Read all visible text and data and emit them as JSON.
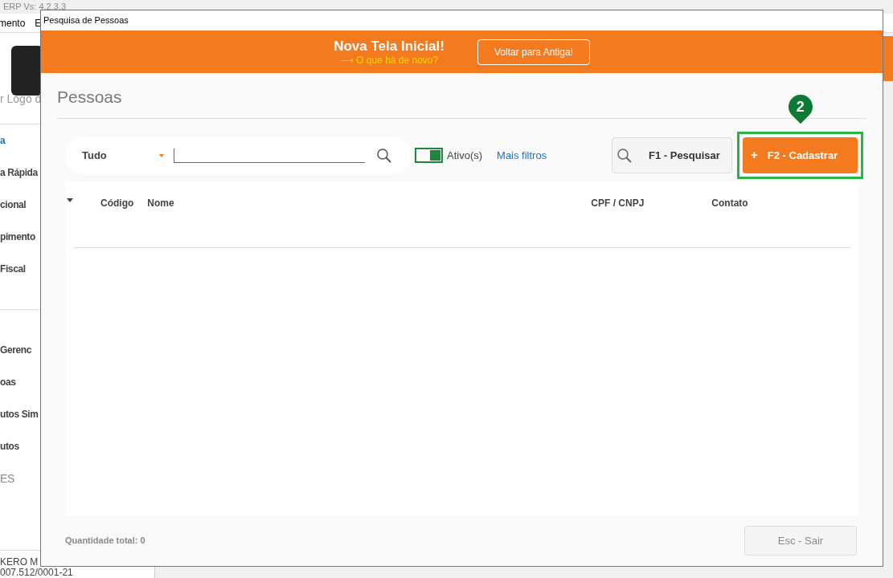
{
  "background_app": {
    "version": "ERP Vs: 4.2.3.3",
    "menu": [
      "mento",
      "E"
    ],
    "logo_caption": "r Logo d",
    "sidebar_groups": [
      [
        {
          "label": "a",
          "kind": "link"
        },
        {
          "label": "a Rápida",
          "kind": "item"
        },
        {
          "label": "cional",
          "kind": "item"
        },
        {
          "label": "pimento",
          "kind": "item"
        },
        {
          "label": "Fiscal",
          "kind": "item"
        }
      ],
      [
        {
          "label": "Gerenc",
          "kind": "item"
        },
        {
          "label": "oas",
          "kind": "item"
        },
        {
          "label": "utos Sim",
          "kind": "item"
        },
        {
          "label": "utos",
          "kind": "item"
        },
        {
          "label": "ES",
          "kind": "plain"
        }
      ]
    ],
    "company": [
      "KERO M",
      "007.512/0001-21"
    ]
  },
  "window": {
    "title": "Pesquisa de Pessoas"
  },
  "banner": {
    "title": "Nova Tela Inicial!",
    "subtitle": "⟶ O que há de novo?",
    "button": "Voltar para Antiga!"
  },
  "page_title": "Pessoas",
  "search": {
    "filter": "Tudo",
    "active_toggle": {
      "on": true,
      "label": "Ativo(s)"
    },
    "more_filters": "Mais filtros"
  },
  "buttons": {
    "search": "F1 - Pesquisar",
    "create": {
      "icon": "+",
      "label": "F2 - Cadastrar"
    },
    "exit": "Esc - Sair"
  },
  "annotation": {
    "number": "2"
  },
  "table": {
    "columns": [
      "Código",
      "Nome",
      "CPF / CNPJ",
      "Contato"
    ]
  },
  "status": "Quantidade total: 0"
}
